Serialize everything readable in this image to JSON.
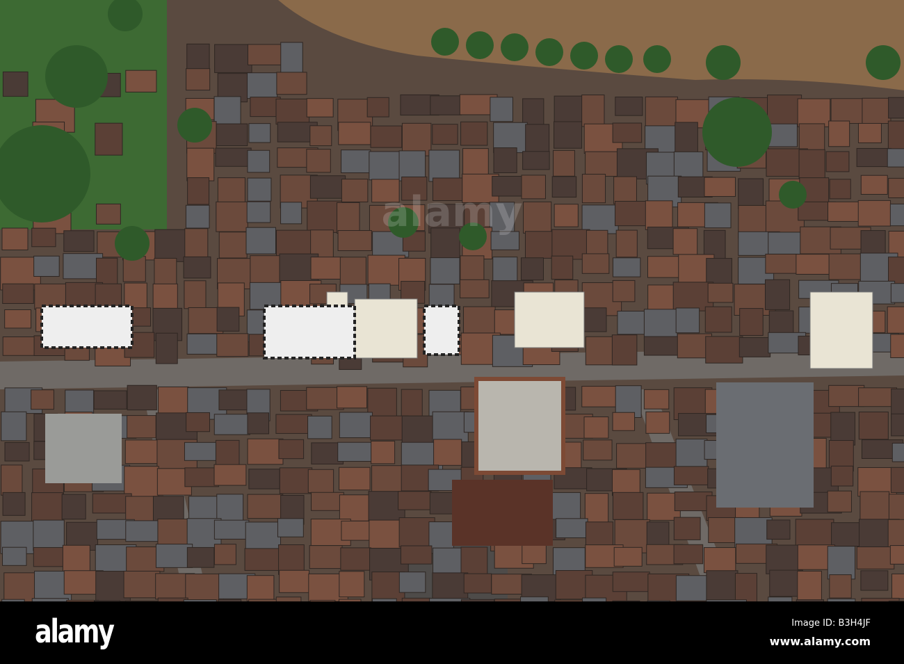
{
  "photo": {
    "subject": "Aerial view of town centre by river",
    "colors": {
      "river": "#8a6a4a",
      "roof": "#6b4a3c",
      "roof_dark": "#4a3b36",
      "slate": "#5e5f63",
      "tree": "#2f5a2a",
      "street": "#6f6a66",
      "render": "#e9e4d4"
    }
  },
  "watermark": {
    "overlay": "alamy"
  },
  "footer": {
    "logo": "alamy",
    "image_id": "Image ID: B3H4JF",
    "url": "www.alamy.com"
  }
}
